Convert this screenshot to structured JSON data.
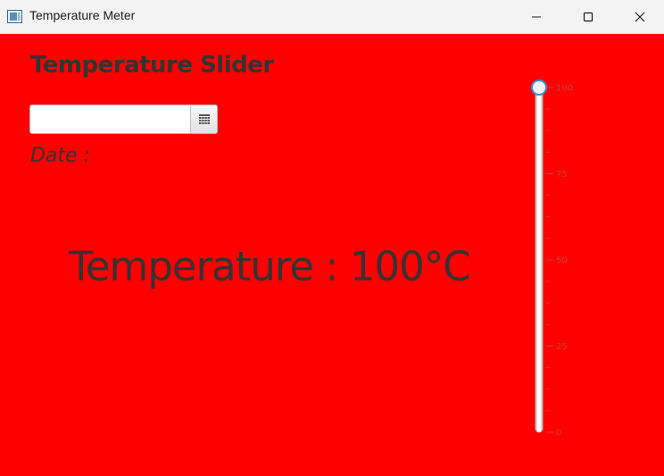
{
  "window": {
    "title": "Temperature Meter",
    "background_color": "#ff0000",
    "controls": {
      "minimize": "minimize",
      "maximize": "maximize",
      "close": "close"
    }
  },
  "main": {
    "heading": "Temperature Slider",
    "date_picker": {
      "value": "",
      "placeholder": "",
      "calendar_icon": "calendar-icon"
    },
    "date_label": "Date :",
    "temperature_label": "Temperature : 100°C"
  },
  "slider": {
    "orientation": "vertical",
    "min": 0,
    "max": 100,
    "value": 100,
    "major_tick_unit": 25,
    "minor_ticks_per_major": 4,
    "tick_labels": [
      "100",
      "75",
      "50",
      "25",
      "0"
    ]
  }
}
